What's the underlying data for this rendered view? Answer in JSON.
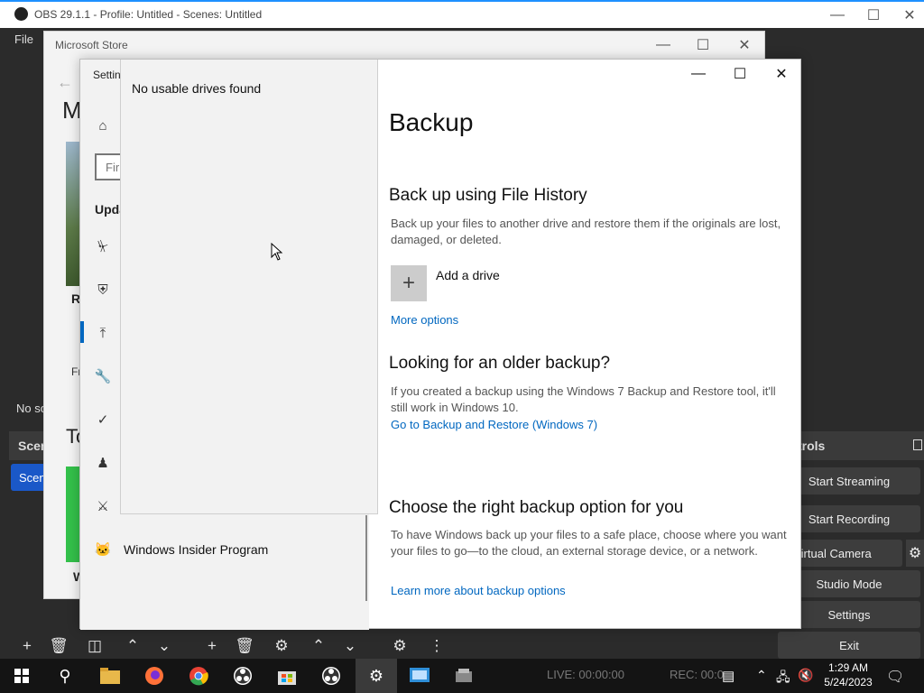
{
  "obs": {
    "title": "OBS 29.1.1 - Profile: Untitled - Scenes: Untitled",
    "menu_file": "File",
    "no_source": "No so",
    "scenes_header": "Scen",
    "scene_item": "Scen",
    "controls_header": "trols",
    "buttons": {
      "start_streaming": "Start Streaming",
      "start_recording": "Start Recording",
      "virtual_camera": "t Virtual Camera",
      "studio_mode": "Studio Mode",
      "settings": "Settings",
      "exit": "Exit"
    },
    "status": {
      "live": "LIVE: 00:00:00",
      "rec": "REC: 00:0"
    }
  },
  "store": {
    "title": "Microsoft Store",
    "heading_fragment": "M",
    "to_fragment": "To",
    "r_fragment": "R",
    "fr_fragment": "Fr",
    "w_fragment": "W"
  },
  "settings": {
    "window_title": "Settin",
    "search_placeholder": "Fir",
    "section_label": "Upda",
    "dropdown_message": "No usable drives found",
    "insider_program": "Windows Insider Program",
    "page_title": "Backup",
    "file_history": {
      "heading": "Back up using File History",
      "description": "Back up your files to another drive and restore them if the originals are lost, damaged, or deleted.",
      "add_drive": "Add a drive",
      "more_options": "More options"
    },
    "older_backup": {
      "heading": "Looking for an older backup?",
      "description": "If you created a backup using the Windows 7 Backup and Restore tool, it'll still work in Windows 10.",
      "link": "Go to Backup and Restore (Windows 7)"
    },
    "right_option": {
      "heading": "Choose the right backup option for you",
      "description": "To have Windows back up your files to a safe place, choose where you want your files to go—to the cloud, an external storage device, or a network.",
      "link": "Learn more about backup options"
    }
  },
  "taskbar": {
    "time": "1:29 AM",
    "date": "5/24/2023"
  },
  "colors": {
    "accent": "#0067c0",
    "obs_scene_active": "#1a58c8",
    "taskbar": "#141414"
  }
}
